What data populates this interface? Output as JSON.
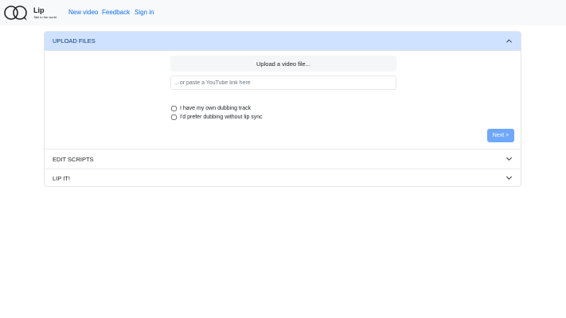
{
  "navbar": {
    "brand": "Lip",
    "tagline": "Talk to the world",
    "links": [
      "New video",
      "Feedback",
      "Sign in"
    ]
  },
  "accordion": {
    "upload": {
      "title": "UPLOAD FILES",
      "upload_button": "Upload a video file...",
      "youtube_placeholder": "...or paste a YouTube link here",
      "youtube_value": "",
      "checkboxes": [
        {
          "label": "I have my own dubbing track",
          "checked": false
        },
        {
          "label": "I'd prefer dubbing without lip sync",
          "checked": false
        }
      ],
      "next_button": "Next >"
    },
    "edit": {
      "title": "EDIT SCRIPTS"
    },
    "lip": {
      "title": "LIP IT!"
    }
  },
  "colors": {
    "accent": "#0d6efd",
    "header_active": "#cfe2ff",
    "next_button": "#6ea8fe"
  },
  "icons": {
    "logo": "overlapping-circles-logo",
    "collapse": "chevron-up-icon",
    "expand": "chevron-down-icon"
  }
}
